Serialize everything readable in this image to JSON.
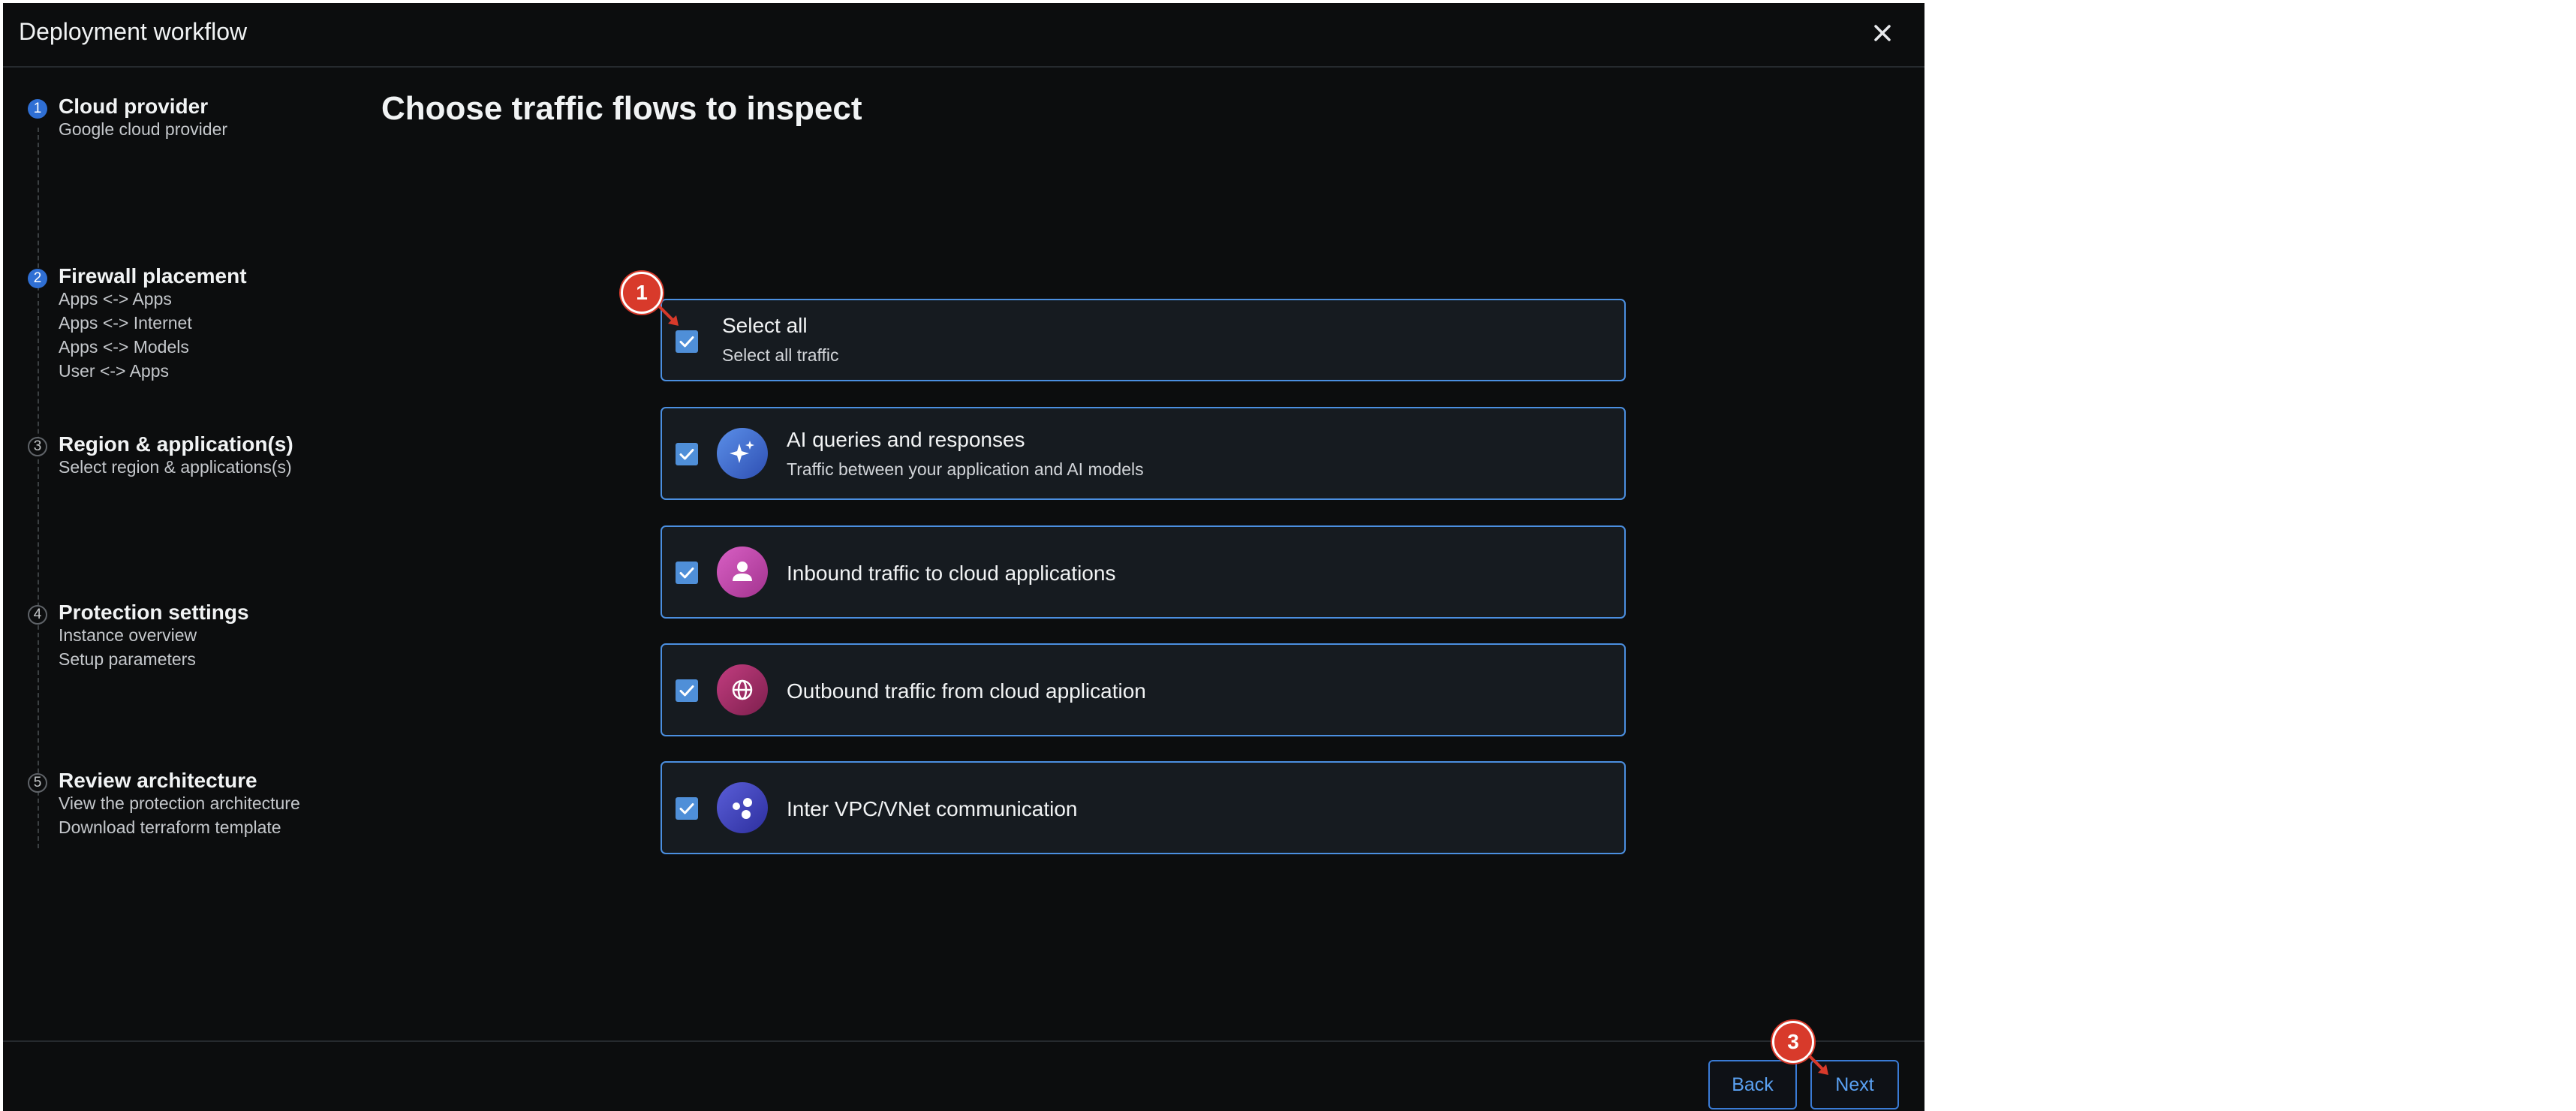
{
  "dialog": {
    "title": "Deployment workflow",
    "close_icon": "close-icon"
  },
  "stepper": {
    "steps": [
      {
        "number": "1",
        "title": "Cloud provider",
        "subtitles": [
          "Google cloud provider"
        ],
        "state": "active"
      },
      {
        "number": "2",
        "title": "Firewall placement",
        "subtitles": [
          "Apps <-> Apps",
          "Apps <-> Internet",
          "Apps <-> Models",
          "User <-> Apps"
        ],
        "state": "active"
      },
      {
        "number": "3",
        "title": "Region & application(s)",
        "subtitles": [
          "Select region & applications(s)"
        ],
        "state": "inactive"
      },
      {
        "number": "4",
        "title": "Protection settings",
        "subtitles": [
          "Instance overview",
          "Setup parameters"
        ],
        "state": "inactive"
      },
      {
        "number": "5",
        "title": "Review architecture",
        "subtitles": [
          "View the protection architecture",
          "Download terraform template"
        ],
        "state": "inactive"
      }
    ]
  },
  "main": {
    "heading": "Choose traffic flows to inspect",
    "options": [
      {
        "title": "Select all",
        "subtitle": "Select all traffic",
        "checked": true,
        "icon": ""
      },
      {
        "title": "AI queries and responses",
        "subtitle": "Traffic between your application and AI models",
        "checked": true,
        "icon": "sparkle-icon"
      },
      {
        "title": "Inbound traffic to cloud applications",
        "subtitle": "",
        "checked": true,
        "icon": "user-icon"
      },
      {
        "title": "Outbound traffic from cloud application",
        "subtitle": "",
        "checked": true,
        "icon": "globe-icon"
      },
      {
        "title": "Inter VPC/VNet communication",
        "subtitle": "",
        "checked": true,
        "icon": "network-nodes-icon"
      }
    ]
  },
  "footer": {
    "back_label": "Back",
    "next_label": "Next"
  },
  "annotations": {
    "marker_1": "1",
    "marker_3": "3"
  },
  "colors": {
    "background": "#0c0d0e",
    "card_border": "#4b8fe0",
    "accent": "#4f8fd8",
    "marker": "#d83a2b"
  }
}
